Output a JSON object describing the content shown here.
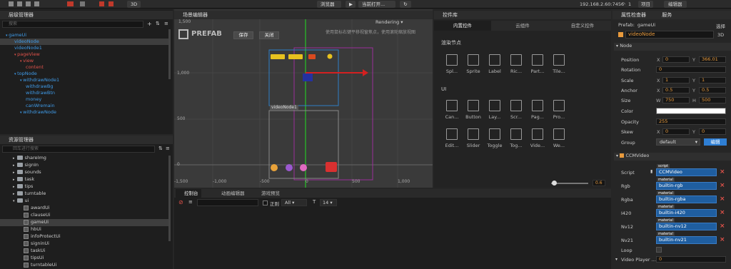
{
  "toolbar": {
    "preview_label": "浏览器",
    "current_open_label": "当前打开...",
    "mode_3d": "3D",
    "ip": "192.168.2.60:7456",
    "wifi_count": "1",
    "project_label": "项目",
    "editor_label": "编辑器"
  },
  "hierarchy": {
    "title": "层级管理器",
    "search_placeholder": "搜索",
    "items": [
      {
        "label": "gameUi",
        "color": "#3f9be8"
      },
      {
        "label": "videoNode",
        "color": "#3f9be8"
      },
      {
        "label": "videoNode1",
        "color": "#3f9be8"
      },
      {
        "label": "pageView",
        "color": "#e0524a"
      },
      {
        "label": "view",
        "color": "#e0524a"
      },
      {
        "label": "content",
        "color": "#e0524a"
      },
      {
        "label": "topNode",
        "color": "#3f9be8"
      },
      {
        "label": "withdrawNode1",
        "color": "#3f9be8"
      },
      {
        "label": "withdrawBg",
        "color": "#3f9be8"
      },
      {
        "label": "withdrawBtn",
        "color": "#3f9be8"
      },
      {
        "label": "money",
        "color": "#3f9be8"
      },
      {
        "label": "canWremain",
        "color": "#3f9be8"
      },
      {
        "label": "withdrawNode",
        "color": "#3f9be8"
      }
    ]
  },
  "assets": {
    "title": "资源管理器",
    "search_placeholder": "回车进行搜索",
    "items": [
      "shareImg",
      "signIn",
      "sounds",
      "task",
      "tips",
      "turntable",
      "ui",
      "awardUi",
      "clauseUi",
      "gameUi",
      "hbUi",
      "infoProtectUi",
      "signinUi",
      "taskUi",
      "tipsUi",
      "turntableUi"
    ]
  },
  "scene": {
    "title": "场景编辑器",
    "prefab_label": "PREFAB",
    "save_label": "保存",
    "close_label": "关闭",
    "hint": "使用鼠标右键平移视窗焦点，使用滚轮缩放视图",
    "rendering": "Rendering",
    "node_label": "videoNode1",
    "y_ticks": [
      "1,000",
      "500",
      "0"
    ],
    "x_ticks": [
      "-1,500",
      "-1,000",
      "-500",
      "0",
      "500",
      "1,000"
    ],
    "top_tick": "1,500",
    "zoom": "0.6"
  },
  "components": {
    "title": "控件库",
    "tabs": [
      "内置控件",
      "云组件",
      "自定义控件"
    ],
    "section_render": "渲染节点",
    "section_ui": "UI",
    "render_items": [
      "Spl...",
      "Sprite",
      "Label",
      "Ric...",
      "Part...",
      "Tile..."
    ],
    "ui_items": [
      "Can...",
      "Button",
      "Lay...",
      "Scr...",
      "Pag...",
      "Pro...",
      "Edit...",
      "Slider",
      "Toggle",
      "Tog...",
      "Vide...",
      "We..."
    ]
  },
  "console": {
    "tabs": [
      "控制台",
      "动画编辑器",
      "游戏预览"
    ],
    "regex_label": "正则",
    "level": "All",
    "font_size": "14"
  },
  "inspector": {
    "title": "属性检查器",
    "service_tab": "服务",
    "prefab_label": "Prefab:",
    "prefab_value": "gameUi",
    "select_label": "选择",
    "node_name": "videoNode",
    "three_d": "3D",
    "node_section": "Node",
    "position": {
      "label": "Position",
      "x": "0",
      "y": "366.01"
    },
    "rotation": {
      "label": "Rotation",
      "value": "0"
    },
    "scale": {
      "label": "Scale",
      "x": "1",
      "y": "1"
    },
    "anchor": {
      "label": "Anchor",
      "x": "0.5",
      "y": "0.5"
    },
    "size": {
      "label": "Size",
      "w": "750",
      "h": "500"
    },
    "color_label": "Color",
    "opacity": {
      "label": "Opacity",
      "value": "255"
    },
    "skew": {
      "label": "Skew",
      "x": "0",
      "y": "0"
    },
    "group": {
      "label": "Group",
      "value": "default",
      "edit": "编辑"
    },
    "ccm_section": "CCMVideo",
    "script": {
      "label": "Script",
      "tag": "script",
      "value": "CCMVideo"
    },
    "rgb": {
      "label": "Rgb",
      "tag": "material",
      "value": "builtin-rgb"
    },
    "rgba": {
      "label": "Rgba",
      "tag": "material",
      "value": "builtin-rgba"
    },
    "i420": {
      "label": "I420",
      "tag": "material",
      "value": "builtin-i420"
    },
    "nv12": {
      "label": "Nv12",
      "tag": "material",
      "value": "builtin-nv12"
    },
    "nv21": {
      "label": "Nv21",
      "tag": "material",
      "value": "builtin-nv21"
    },
    "loop_label": "Loop",
    "video_player": {
      "label": "Video Player ...",
      "value": "0"
    }
  },
  "colors": {
    "accent_blue": "#3f9be8",
    "accent_red": "#e0524a",
    "orange": "#e89a3c",
    "bg": "#262626"
  }
}
